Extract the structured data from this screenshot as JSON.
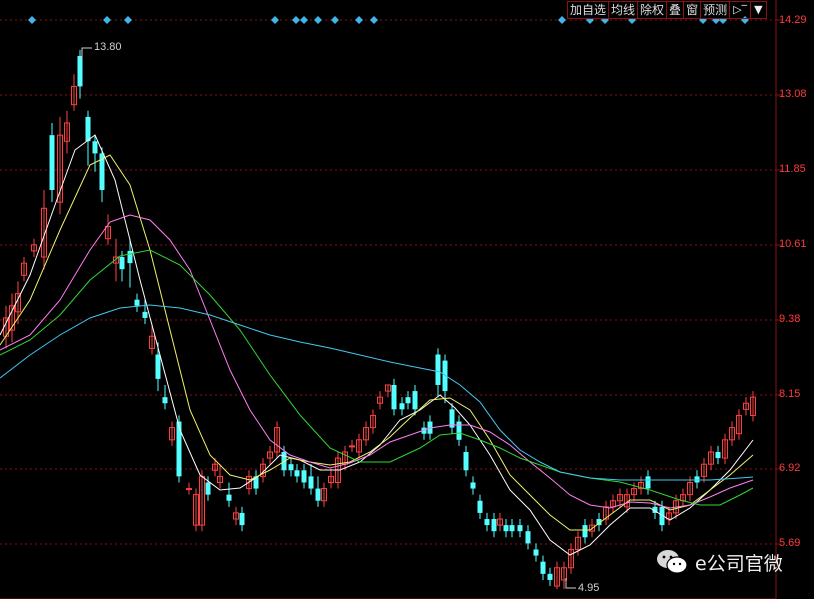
{
  "toolbar": {
    "items": [
      "加自选",
      "均线",
      "除权",
      "叠",
      "窗",
      "预测"
    ],
    "icon_exit": "exit-to-right-icon",
    "icon_dropdown": "dropdown-arrow-icon"
  },
  "price_axis": {
    "labels": [
      "14.29",
      "13.08",
      "11.85",
      "10.61",
      "9.38",
      "8.15",
      "6.92",
      "5.69"
    ]
  },
  "extremes": {
    "high": "13.80",
    "low": "4.95"
  },
  "watermark": {
    "text": "e公司官微",
    "icon": "wechat-icon"
  },
  "colors": {
    "background": "#000000",
    "grid": "#8a1212",
    "axis_text": "#ff3a3a",
    "up_candle": "#ff4040",
    "down_candle": "#54ffff",
    "ma_white": "#ffffff",
    "ma_yellow": "#f2f26a",
    "ma_pink": "#ff7ff2",
    "ma_green": "#33d633",
    "ma_cyan": "#43c8ef",
    "marker": "#3fb6e9"
  },
  "chart_data": {
    "type": "candlestick",
    "ylim": [
      4.95,
      14.29
    ],
    "grid": true,
    "high": 13.8,
    "low": 4.95
  }
}
